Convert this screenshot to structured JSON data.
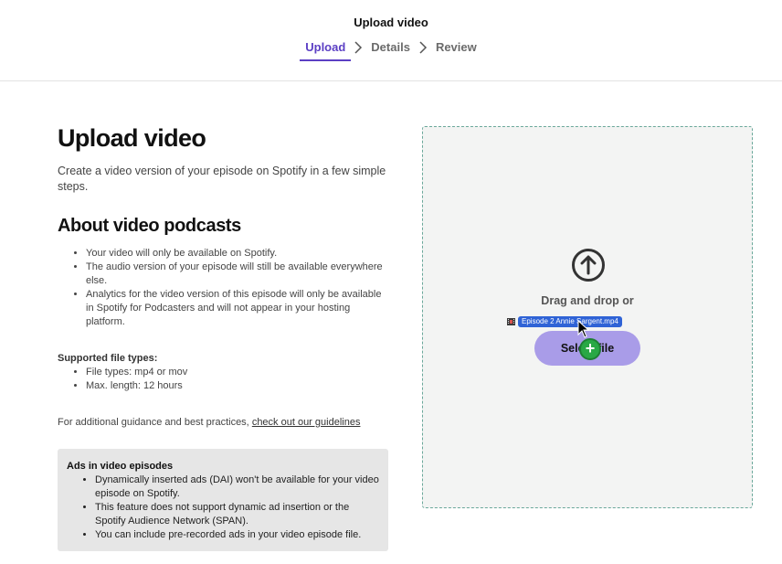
{
  "header": {
    "title": "Upload video",
    "steps": [
      {
        "label": "Upload",
        "active": true
      },
      {
        "label": "Details",
        "active": false
      },
      {
        "label": "Review",
        "active": false
      }
    ]
  },
  "main": {
    "title": "Upload video",
    "intro": "Create a video version of your episode on Spotify in a few simple steps.",
    "about_title": "About video podcasts",
    "about_items": [
      "Your video will only be available on Spotify.",
      "The audio version of your episode will still be available everywhere else.",
      "Analytics for the video version of this episode will only be available in Spotify for Podcasters and will not appear in your hosting platform."
    ],
    "types_label": "Supported file types:",
    "types_items": [
      "File types: mp4 or mov",
      "Max. length: 12 hours"
    ],
    "guidance_text": "For additional guidance and best practices, ",
    "guidance_link": "check out our guidelines",
    "ads": {
      "title": "Ads in video episodes",
      "items": [
        "Dynamically inserted ads (DAI) won't be available for your video episode on Spotify.",
        "This feature does not support dynamic ad insertion or the Spotify Audience Network (SPAN).",
        "You can include pre-recorded ads in your video episode file."
      ]
    }
  },
  "dropzone": {
    "prompt": "Drag and drop or",
    "button_label": "Select file",
    "dragging_file": "Episode 2 Annie Sargent.mp4",
    "icon": "upload-arrow-icon"
  },
  "colors": {
    "accent": "#5b3fc4",
    "button": "#a99ce8",
    "drop_border": "#6aa89a",
    "drag_plus": "#29a845",
    "drag_label": "#2f63d6"
  }
}
